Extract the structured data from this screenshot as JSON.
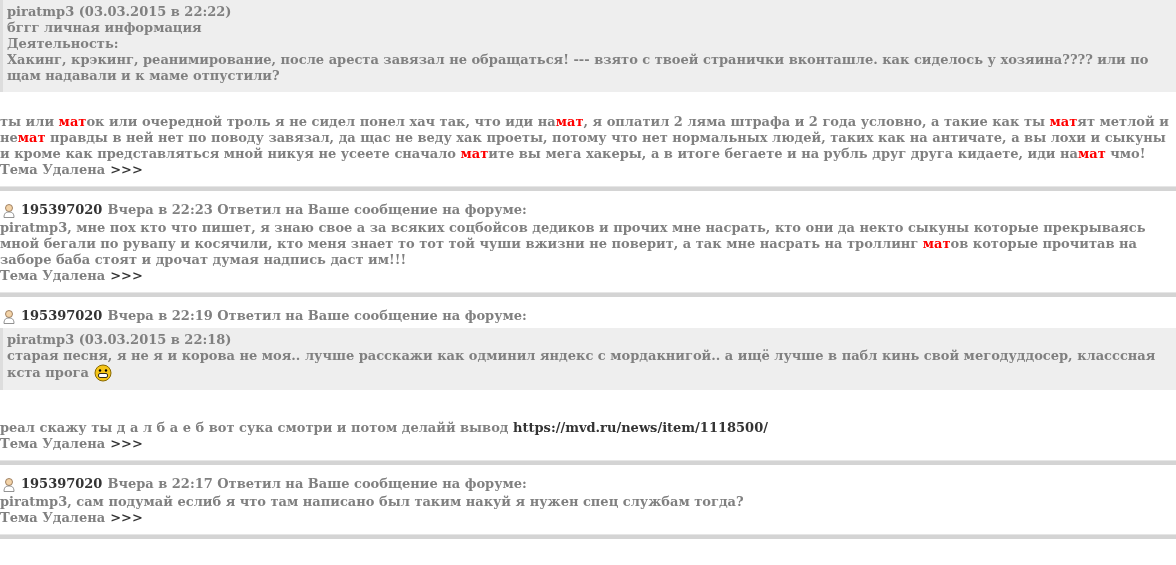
{
  "posts": [
    {
      "quote": {
        "author": "piratmp3 (03.03.2015 в 22:22)",
        "body": [
          {
            "kind": "line",
            "text": "бггг личная информация"
          },
          {
            "kind": "line",
            "text": "Деятельность:"
          },
          {
            "kind": "plain",
            "text": "Хакинг, крэкинг, реанимирование, после ареста завязал не обращаться! --- взято с твоей странички вконташле. как сиделось у хозяина???? или по щам надавали и к маме отпустили?"
          }
        ]
      },
      "body": [
        {
          "kind": "plain",
          "text": "ты или "
        },
        {
          "kind": "censor",
          "text": "мат"
        },
        {
          "kind": "plain",
          "text": "ок или очередной троль я не сидел понел хач так, что иди на"
        },
        {
          "kind": "censor",
          "text": "мат"
        },
        {
          "kind": "plain",
          "text": ", я оплатил 2 ляма штрафа и 2 года условно, а такие как ты "
        },
        {
          "kind": "censor",
          "text": "мат"
        },
        {
          "kind": "plain",
          "text": "ят метлой и не"
        },
        {
          "kind": "censor",
          "text": "мат"
        },
        {
          "kind": "plain",
          "text": " правды в ней нет по поводу завязал, да щас не веду хак проеты, потому что нет нормальных людей, таких как на античате, а вы лохи и сыкуны и кроме как представляться мной никуя не усеете сначало "
        },
        {
          "kind": "censor",
          "text": "мат"
        },
        {
          "kind": "plain",
          "text": "ите вы мега хакеры, а в итоге бегаете и на рубль друг друга кидаете, иди на"
        },
        {
          "kind": "censor",
          "text": "мат"
        },
        {
          "kind": "plain",
          "text": " чмо!"
        }
      ],
      "footer": {
        "label": "Тема Удалена",
        "link": ">>>"
      }
    },
    {
      "header": {
        "user": "195397020",
        "meta": "Вчера в 22:23 Ответил на Ваше сообщение на форуме:"
      },
      "body": [
        {
          "kind": "plain",
          "text": "piratmp3, мне пох кто что пишет, я знаю свое а за всяких соцбойсов дедиков и прочих мне насрать, кто они да некто сыкуны которые прекрываясь мной бегали по рувапу и косячили, кто меня знает то тот той чуши вжизни не поверит, а так мне насрать на троллинг "
        },
        {
          "kind": "censor",
          "text": "мат"
        },
        {
          "kind": "plain",
          "text": "ов которые прочитав на заборе баба стоят и дрочат думая надпись даст им!!!"
        }
      ],
      "footer": {
        "label": "Тема Удалена",
        "link": ">>>"
      }
    },
    {
      "header": {
        "user": "195397020",
        "meta": "Вчера в 22:19 Ответил на Ваше сообщение на форуме:"
      },
      "quote": {
        "author": "piratmp3 (03.03.2015 в 22:18)",
        "body": [
          {
            "kind": "plain",
            "text": "старая песня, я не я и корова не моя.. лучше расскажи как одминил яндекс с мордакнигой.. а ищё лучше в пабл кинь свой мегодуддосер, класссная кста прога "
          },
          {
            "kind": "smiley"
          }
        ]
      },
      "body": [
        {
          "kind": "plain",
          "text": "реал скажу ты д а л б а е б вот сука смотри и потом делайй вывод "
        },
        {
          "kind": "link",
          "text": "https://mvd.ru/news/item/1118500/"
        }
      ],
      "footer": {
        "label": "Тема Удалена",
        "link": ">>>"
      }
    },
    {
      "header": {
        "user": "195397020",
        "meta": "Вчера в 22:17 Ответил на Ваше сообщение на форуме:"
      },
      "body": [
        {
          "kind": "plain",
          "text": "piratmp3, сам подумай еслиб я что там написано был таким накуй я нужен спец службам тогда?"
        }
      ],
      "footer": {
        "label": "Тема Удалена",
        "link": ">>>"
      }
    }
  ]
}
